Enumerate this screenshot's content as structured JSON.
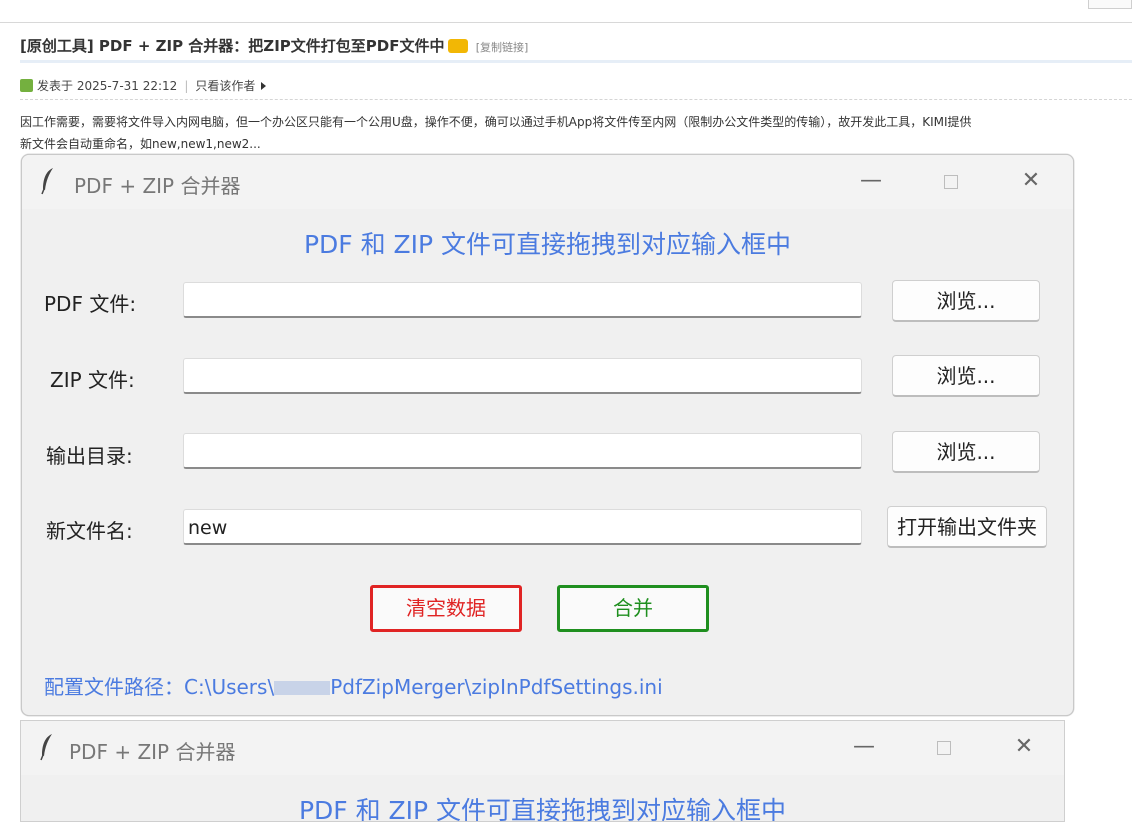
{
  "post": {
    "title": "[原创工具] PDF + ZIP 合并器：把ZIP文件打包至PDF文件中",
    "copy_link": "[复制链接]",
    "posted": "发表于 2025-7-31 22:12",
    "author_only": "只看该作者",
    "line1": "因工作需要，需要将文件导入内网电脑，但一个办公区只能有一个公用U盘，操作不便，确可以通过手机App将文件传至内网（限制办公文件类型的传输），故开发此工具，KIMI提供",
    "line2": "新文件会自动重命名，如new,new1,new2..."
  },
  "window": {
    "title": "PDF + ZIP 合并器",
    "heading": "PDF 和 ZIP 文件可直接拖拽到对应输入框中",
    "pdf_label": "PDF 文件:",
    "zip_label": "ZIP 文件:",
    "out_label": "输出目录:",
    "name_label": "新文件名:",
    "browse": "浏览...",
    "pdf_value": "",
    "zip_value": "",
    "out_value": "",
    "name_value": "new",
    "open_output": "打开输出文件夹",
    "clear": "清空数据",
    "merge": "合并",
    "config_prefix": "配置文件路径：C:\\Users\\",
    "config_suffix": "PdfZipMerger\\zipInPdfSettings.ini",
    "accent_color": "#4b7be0",
    "danger_color": "#e02424",
    "success_color": "#1f8f1f"
  },
  "window2": {
    "title": "PDF + ZIP 合并器",
    "heading": "PDF 和 ZIP 文件可直接拖拽到对应输入框中"
  }
}
